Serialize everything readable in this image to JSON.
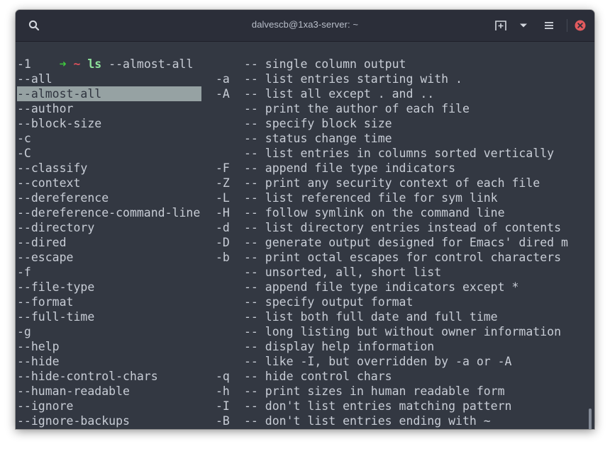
{
  "window": {
    "title": "dalvescb@1xa3-server: ~"
  },
  "titlebar": {
    "search_icon": "search-icon",
    "new_tab_icon": "new-tab-icon",
    "dropdown_icon": "chevron-down-icon",
    "menu_icon": "hamburger-menu-icon",
    "close_icon": "close-icon",
    "close_color": "#e25a5e"
  },
  "prompt": {
    "arrow": "➜",
    "cwd": "~",
    "command": "ls",
    "args": "--almost-all"
  },
  "completions": [
    {
      "opt": "-1",
      "short": "",
      "desc": "-- single column output"
    },
    {
      "opt": "--all",
      "short": "-a",
      "desc": "-- list entries starting with ."
    },
    {
      "opt": "--almost-all",
      "short": "-A",
      "desc": "-- list all except . and ..",
      "selected": true
    },
    {
      "opt": "--author",
      "short": "",
      "desc": "-- print the author of each file"
    },
    {
      "opt": "--block-size",
      "short": "",
      "desc": "-- specify block size"
    },
    {
      "opt": "-c",
      "short": "",
      "desc": "-- status change time"
    },
    {
      "opt": "-C",
      "short": "",
      "desc": "-- list entries in columns sorted vertically"
    },
    {
      "opt": "--classify",
      "short": "-F",
      "desc": "-- append file type indicators"
    },
    {
      "opt": "--context",
      "short": "-Z",
      "desc": "-- print any security context of each file"
    },
    {
      "opt": "--dereference",
      "short": "-L",
      "desc": "-- list referenced file for sym link"
    },
    {
      "opt": "--dereference-command-line",
      "short": "-H",
      "desc": "-- follow symlink on the command line"
    },
    {
      "opt": "--directory",
      "short": "-d",
      "desc": "-- list directory entries instead of contents"
    },
    {
      "opt": "--dired",
      "short": "-D",
      "desc": "-- generate output designed for Emacs' dired m"
    },
    {
      "opt": "--escape",
      "short": "-b",
      "desc": "-- print octal escapes for control characters"
    },
    {
      "opt": "-f",
      "short": "",
      "desc": "-- unsorted, all, short list"
    },
    {
      "opt": "--file-type",
      "short": "",
      "desc": "-- append file type indicators except *"
    },
    {
      "opt": "--format",
      "short": "",
      "desc": "-- specify output format"
    },
    {
      "opt": "--full-time",
      "short": "",
      "desc": "-- list both full date and full time"
    },
    {
      "opt": "-g",
      "short": "",
      "desc": "-- long listing but without owner information"
    },
    {
      "opt": "--help",
      "short": "",
      "desc": "-- display help information"
    },
    {
      "opt": "--hide",
      "short": "",
      "desc": "-- like -I, but overridden by -a or -A"
    },
    {
      "opt": "--hide-control-chars",
      "short": "-q",
      "desc": "-- hide control chars"
    },
    {
      "opt": "--human-readable",
      "short": "-h",
      "desc": "-- print sizes in human readable form"
    },
    {
      "opt": "--ignore",
      "short": "-I",
      "desc": "-- don't list entries matching pattern"
    },
    {
      "opt": "--ignore-backups",
      "short": "-B",
      "desc": "-- don't list entries ending with ~"
    }
  ]
}
